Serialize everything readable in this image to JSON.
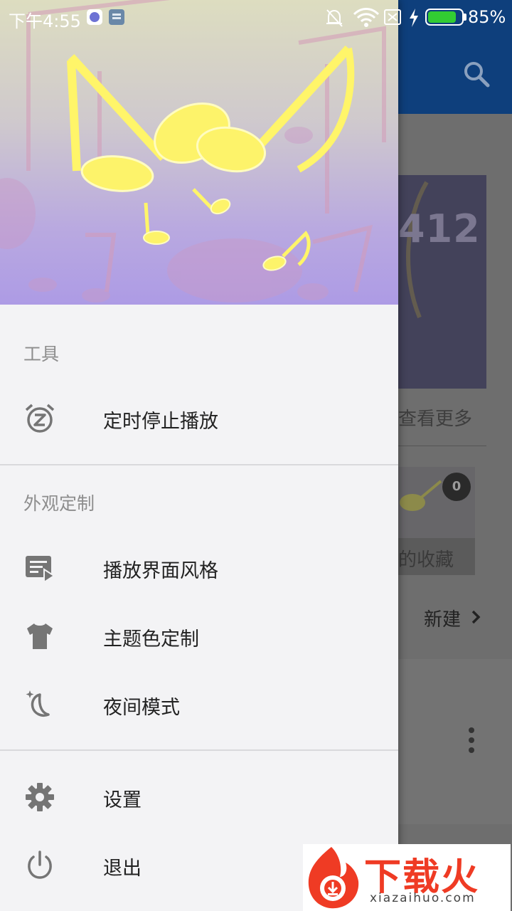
{
  "status_bar": {
    "time": "下午4:55",
    "battery_percent": "85%",
    "battery_level": 0.85,
    "battery_color": "#32cc32"
  },
  "background_screen": {
    "toolbar_color": "#0e3f7c",
    "search_icon": "search-icon",
    "card_number": "412",
    "see_more": "查看更多",
    "favorites_label": "的收藏",
    "favorites_count": "0",
    "new_playlist": "新建",
    "more_icon": "more-vert-icon"
  },
  "drawer": {
    "sections": [
      {
        "title": "工具",
        "items": [
          {
            "label": "定时停止播放",
            "icon": "alarm-timer-icon"
          }
        ]
      },
      {
        "title": "外观定制",
        "items": [
          {
            "label": "播放界面风格",
            "icon": "player-style-icon"
          },
          {
            "label": "主题色定制",
            "icon": "tshirt-icon"
          },
          {
            "label": "夜间模式",
            "icon": "moon-icon"
          }
        ]
      },
      {
        "title": "",
        "items": [
          {
            "label": "设置",
            "icon": "gear-icon"
          },
          {
            "label": "退出",
            "icon": "power-icon"
          }
        ]
      }
    ]
  },
  "watermark": {
    "brand": "下载火",
    "url": "xiazaihuo.com",
    "color": "#ef3b24"
  }
}
